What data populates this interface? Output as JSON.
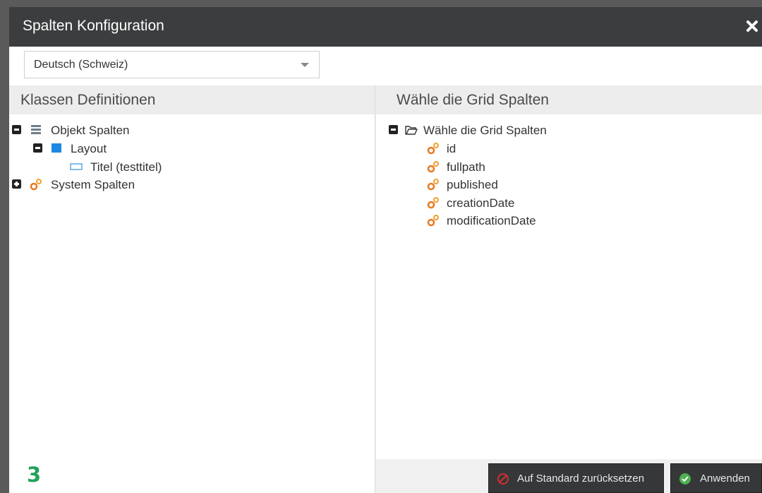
{
  "dialog": {
    "title": "Spalten Konfiguration",
    "close_icon": "close-icon"
  },
  "language": {
    "selected": "Deutsch (Schweiz)"
  },
  "left_panel": {
    "header": "Klassen Definitionen",
    "tree": [
      {
        "label": "Objekt Spalten",
        "expanded": true,
        "icon": "table-icon"
      },
      {
        "label": "Layout",
        "expanded": true,
        "icon": "layout-icon"
      },
      {
        "label": "Titel (testtitel)",
        "icon": "input-field-icon"
      },
      {
        "label": "System Spalten",
        "expanded": false,
        "icon": "gears-icon"
      }
    ]
  },
  "right_panel": {
    "header": "Wähle die Grid Spalten",
    "root": {
      "label": "Wähle die Grid Spalten",
      "expanded": true,
      "icon": "folder-open-icon"
    },
    "columns": [
      "id",
      "fullpath",
      "published",
      "creationDate",
      "modificationDate"
    ]
  },
  "buttons": {
    "reset": "Auf Standard zurücksetzen",
    "apply": "Anwenden"
  },
  "watermark": "3",
  "colors": {
    "titlebar": "#3b3d3e",
    "button": "#353738",
    "gear_orange": "#e8791f",
    "layout_blue": "#1e88e5",
    "apply_green": "#4caf50",
    "reset_red": "#d32f2f"
  }
}
